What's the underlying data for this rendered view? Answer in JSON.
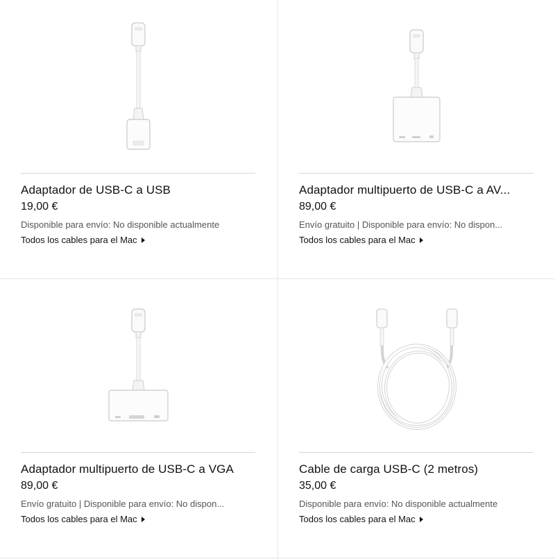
{
  "products": [
    {
      "title": "Adaptador de USB-C a USB",
      "price": "19,00 €",
      "availability": "Disponible para envío: No disponible actualmente",
      "link": "Todos los cables para el Mac",
      "image_icon": "usb-c-to-usb-adapter-icon"
    },
    {
      "title": "Adaptador multipuerto de USB-C a AV...",
      "price": "89,00 €",
      "availability": "Envío gratuito | Disponible para envío: No dispon...",
      "link": "Todos los cables para el Mac",
      "image_icon": "usb-c-digital-av-multiport-adapter-icon"
    },
    {
      "title": "Adaptador multipuerto de USB-C a VGA",
      "price": "89,00 €",
      "availability": "Envío gratuito | Disponible para envío: No dispon...",
      "link": "Todos los cables para el Mac",
      "image_icon": "usb-c-vga-multiport-adapter-icon"
    },
    {
      "title": "Cable de carga USB-C (2 metros)",
      "price": "35,00 €",
      "availability": "Disponible para envío: No disponible actualmente",
      "link": "Todos los cables para el Mac",
      "image_icon": "usb-c-charge-cable-icon"
    }
  ]
}
